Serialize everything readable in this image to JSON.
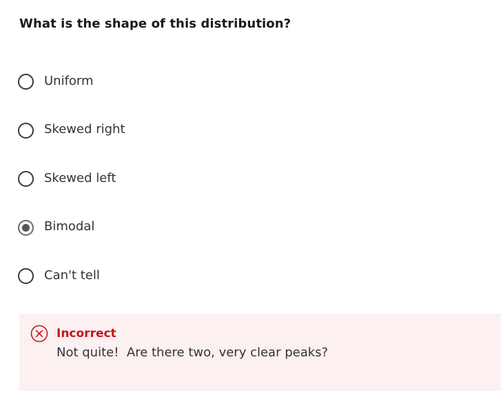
{
  "question": {
    "text": "What is the shape of this distribution?"
  },
  "options": [
    {
      "label": "Uniform",
      "selected": false
    },
    {
      "label": "Skewed right",
      "selected": false
    },
    {
      "label": "Skewed left",
      "selected": false
    },
    {
      "label": "Bimodal",
      "selected": true
    },
    {
      "label": "Can't tell",
      "selected": false
    }
  ],
  "feedback": {
    "status": "Incorrect",
    "message": "Not quite!  Are there two, very clear peaks?",
    "icon": "error-circle-x-icon",
    "accent_color": "#c4161c",
    "background_color": "#fcf0f1"
  }
}
